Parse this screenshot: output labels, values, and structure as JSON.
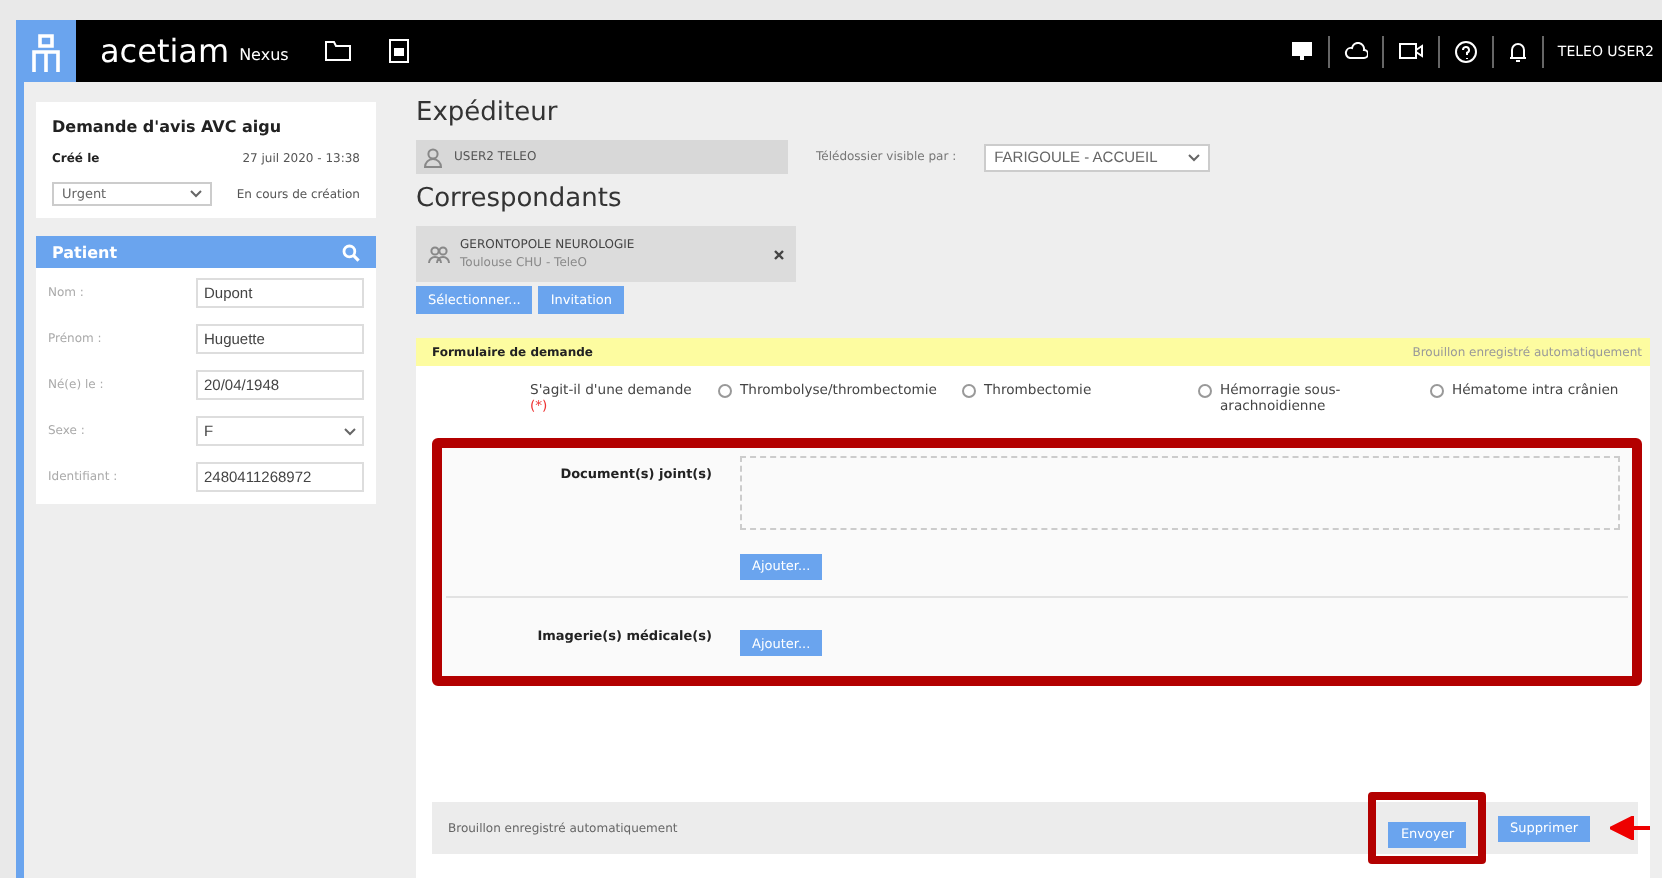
{
  "header": {
    "brand": "acetiam",
    "product": "Nexus",
    "user": "TELEO USER2"
  },
  "request": {
    "title": "Demande d'avis AVC aigu",
    "created_label": "Créé le",
    "created_value": "27 juil 2020 - 13:38",
    "priority": "Urgent",
    "status": "En cours de création"
  },
  "patient": {
    "title": "Patient",
    "fields": [
      {
        "label": "Nom :",
        "value": "Dupont",
        "kind": "text"
      },
      {
        "label": "Prénom :",
        "value": "Huguette",
        "kind": "text"
      },
      {
        "label": "Né(e) le :",
        "value": "20/04/1948",
        "kind": "text"
      },
      {
        "label": "Sexe :",
        "value": "F",
        "kind": "select"
      },
      {
        "label": "Identifiant :",
        "value": "2480411268972",
        "kind": "text"
      }
    ]
  },
  "sender": {
    "title": "Expéditeur",
    "name": "USER2 TELEO",
    "visibility_label": "Télédossier visible par :",
    "visibility_value": "FARIGOULE - ACCUEIL"
  },
  "recipients": {
    "title": "Correspondants",
    "items": [
      {
        "name": "GERONTOPOLE NEUROLOGIE",
        "subtitle": "Toulouse CHU - TeleO"
      }
    ],
    "buttons": [
      "Sélectionner...",
      "Invitation"
    ]
  },
  "form": {
    "title": "Formulaire de demande",
    "autosave": "Brouillon enregistré automatiquement",
    "question": {
      "label": "S'agit-il d'une demande",
      "required": "(*)",
      "options": [
        {
          "label": "Thrombolyse/thrombectomie",
          "selected": false
        },
        {
          "label": "Thrombectomie",
          "selected": false
        },
        {
          "label": "Hémorragie sous-arachnoidienne",
          "selected": false
        },
        {
          "label": "Hématome intra crânien",
          "selected": false
        }
      ]
    },
    "attachments": [
      {
        "label": "Document(s) joint(s)",
        "button": "Ajouter...",
        "kind": "dropzone"
      },
      {
        "label": "Imagerie(s) médicale(s)",
        "button": "Ajouter...",
        "kind": "button"
      }
    ]
  },
  "footer": {
    "status": "Brouillon enregistré automatiquement",
    "buttons": [
      "Envoyer",
      "Supprimer"
    ]
  }
}
